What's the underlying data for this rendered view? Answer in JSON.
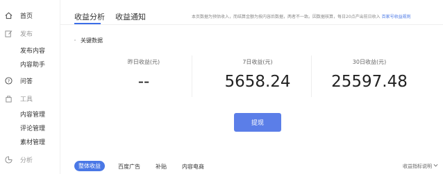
{
  "sidebar": {
    "items": [
      {
        "label": "首页",
        "icon": "home-icon"
      },
      {
        "label": "发布",
        "icon": "edit-icon"
      },
      {
        "label": "发布内容"
      },
      {
        "label": "内容助手"
      },
      {
        "label": "问答",
        "icon": "question-icon"
      },
      {
        "label": "工具",
        "icon": "toolbox-icon"
      },
      {
        "label": "内容管理"
      },
      {
        "label": "评论管理"
      },
      {
        "label": "素材管理"
      },
      {
        "label": "分析",
        "icon": "analytics-icon"
      }
    ]
  },
  "header": {
    "tabs": [
      {
        "label": "收益分析"
      },
      {
        "label": "收益通知"
      }
    ],
    "notice_text": "本页数据为预估收入，而结算金额为按内容后数据，两者不一致。因数据核算，每日20点产出前日收入",
    "notice_link": "百家号收益规则"
  },
  "key_data": {
    "title": "关键数据",
    "stats": [
      {
        "label": "昨日收益(元)",
        "value": "--"
      },
      {
        "label": "7日收益(元)",
        "value": "5658.24"
      },
      {
        "label": "30日收益(元)",
        "value": "25597.48"
      }
    ]
  },
  "withdraw_label": "提现",
  "bottom_tabs": [
    {
      "label": "整体收益"
    },
    {
      "label": "百度广告"
    },
    {
      "label": "补贴"
    },
    {
      "label": "内容电商"
    }
  ],
  "metric_link": "收益指标说明",
  "colors": {
    "accent": "#4a78e6",
    "button": "#5b7ee8"
  }
}
